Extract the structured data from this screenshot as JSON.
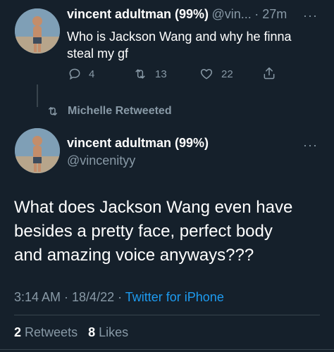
{
  "colors": {
    "background": "#15202b",
    "text": "#ffffff",
    "muted": "#8899a6",
    "link": "#1d9bf0",
    "divider": "#38444d"
  },
  "first_tweet": {
    "display_name": "vincent adultman (99%)",
    "handle_truncated": "@vin...",
    "time": "· 27m",
    "more_icon": "more-dots-icon",
    "text_line1": "Who is Jackson Wang and why he finna",
    "text_line2": "steal my gf",
    "reply_count": "4",
    "retweet_count": "13",
    "like_count": "22"
  },
  "retweet_context": {
    "icon": "retweet-icon",
    "label": "Michelle Retweeted"
  },
  "main_tweet": {
    "display_name": "vincent adultman (99%)",
    "handle": "@vincenityy",
    "more_icon": "more-dots-icon",
    "text_line1": "What does Jackson Wang even have",
    "text_line2": "besides a pretty face, perfect body",
    "text_line3": "and amazing voice anyways???",
    "time": "3:14 AM · 18/4/22 · ",
    "source": "Twitter for iPhone",
    "retweets_count": "2",
    "retweets_label": "Retweets",
    "likes_count": "8",
    "likes_label": "Likes"
  }
}
